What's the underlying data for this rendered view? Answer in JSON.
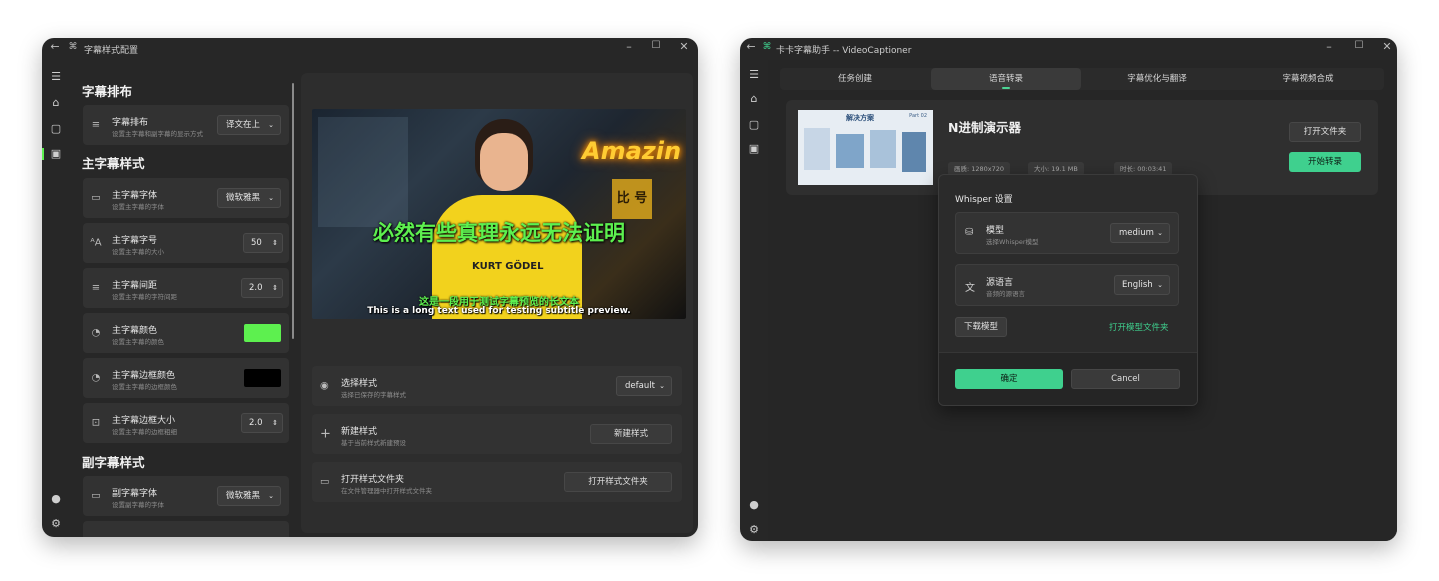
{
  "window1": {
    "title": "字幕样式配置",
    "sections": {
      "layout": "字幕排布",
      "main": "主字幕样式",
      "sub": "副字幕样式"
    },
    "rows": [
      {
        "title": "字幕排布",
        "desc": "设置主字幕和副字幕的显示方式",
        "value": "译文在上",
        "icon": "lines-icon"
      },
      {
        "title": "主字幕字体",
        "desc": "设置主字幕的字体",
        "value": "微软雅黑",
        "icon": "font-icon"
      },
      {
        "title": "主字幕字号",
        "desc": "设置主字幕的大小",
        "value": "50",
        "icon": "font-size-icon"
      },
      {
        "title": "主字幕间距",
        "desc": "设置主字幕的字符间距",
        "value": "2.0",
        "icon": "spacing-icon"
      },
      {
        "title": "主字幕颜色",
        "desc": "设置主字幕的颜色",
        "color": "#5df04f",
        "icon": "palette-icon"
      },
      {
        "title": "主字幕边框颜色",
        "desc": "设置主字幕的边框颜色",
        "color": "#000000",
        "icon": "palette-icon"
      },
      {
        "title": "主字幕边框大小",
        "desc": "设置主字幕的边框粗细",
        "value": "2.0",
        "icon": "border-icon"
      },
      {
        "title": "副字幕字体",
        "desc": "设置副字幕的字体",
        "value": "微软雅黑",
        "icon": "font-icon"
      }
    ],
    "preview": {
      "main_sub": "必然有些真理永远无法证明",
      "cn_sub": "这是一段用于测试字幕预览的长文本",
      "en_sub": "This is a long text used for testing subtitle preview.",
      "neon": "Amazin",
      "shirt": "KURT GÖDEL",
      "sign": "比 号"
    },
    "style_rows": [
      {
        "title": "选择样式",
        "desc": "选择已保存的字幕样式",
        "value": "default",
        "icon": "eye-icon"
      },
      {
        "title": "新建样式",
        "desc": "基于当前样式新建预设",
        "button": "新建样式",
        "icon": "plus-icon"
      },
      {
        "title": "打开样式文件夹",
        "desc": "在文件管理器中打开样式文件夹",
        "button": "打开样式文件夹",
        "icon": "folder-icon"
      }
    ],
    "accent": "#5df04f"
  },
  "window2": {
    "title": "卡卡字幕助手 -- VideoCaptioner",
    "tabs": [
      "任务创建",
      "语音转录",
      "字幕优化与翻译",
      "字幕视频合成"
    ],
    "active_tab": 1,
    "card": {
      "name": "N进制演示器",
      "thumb_title": "解决方案",
      "thumb_badge": "Part 02",
      "resolution": "画质: 1280x720",
      "size": "大小: 19.1 MB",
      "duration": "时长: 00:03:41",
      "open_button": "打开文件夹",
      "start_button": "开始转录"
    },
    "dialog": {
      "title": "Whisper 设置",
      "model_title": "模型",
      "model_desc": "选择Whisper模型",
      "model_value": "medium",
      "lang_title": "源语言",
      "lang_desc": "音频的源语言",
      "lang_value": "English",
      "download_button": "下载模型",
      "open_model_link": "打开模型文件夹",
      "ok_button": "确定",
      "cancel_button": "Cancel"
    },
    "accent": "#3fd08e"
  }
}
